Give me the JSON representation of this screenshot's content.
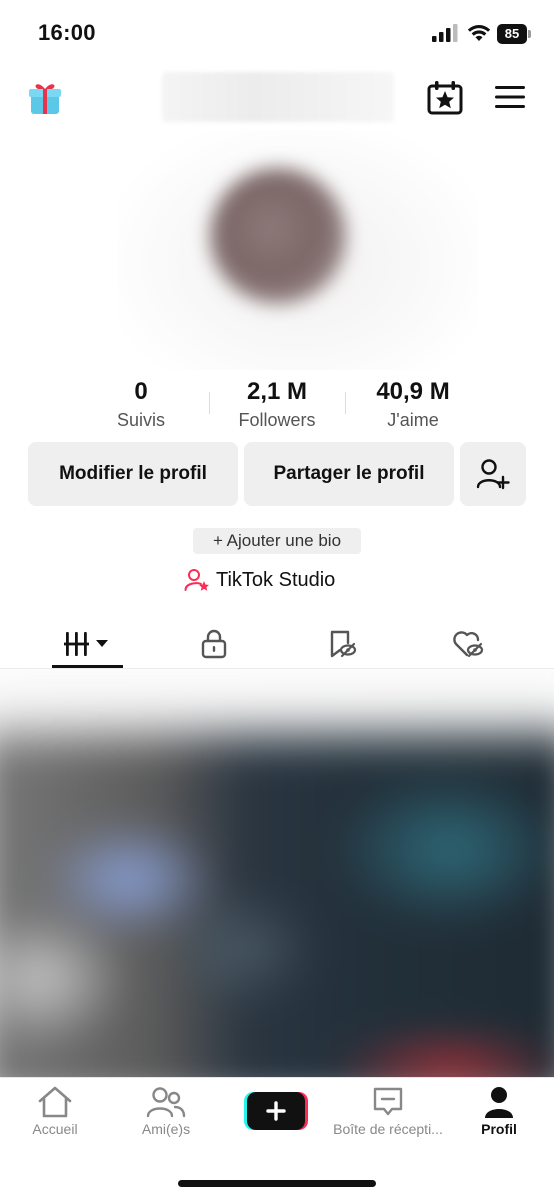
{
  "status_bar": {
    "time": "16:00",
    "battery": "85"
  },
  "stats": [
    {
      "value": "0",
      "label": "Suivis"
    },
    {
      "value": "2,1 M",
      "label": "Followers"
    },
    {
      "value": "40,9 M",
      "label": "J'aime"
    }
  ],
  "actions": {
    "edit_profile": "Modifier le profil",
    "share_profile": "Partager le profil"
  },
  "bio": {
    "add_bio": "+ Ajouter une bio"
  },
  "studio": {
    "label": "TikTok Studio"
  },
  "tabs": [
    "videos",
    "private",
    "reposts",
    "liked"
  ],
  "bottom_nav": {
    "items": [
      {
        "label": "Accueil"
      },
      {
        "label": "Ami(e)s"
      },
      {
        "label": ""
      },
      {
        "label": "Boîte de récepti..."
      },
      {
        "label": "Profil"
      }
    ]
  },
  "colors": {
    "accent_pink": "#fe2c55",
    "accent_cyan": "#25f4ee",
    "text": "#111111",
    "muted": "#888888"
  }
}
